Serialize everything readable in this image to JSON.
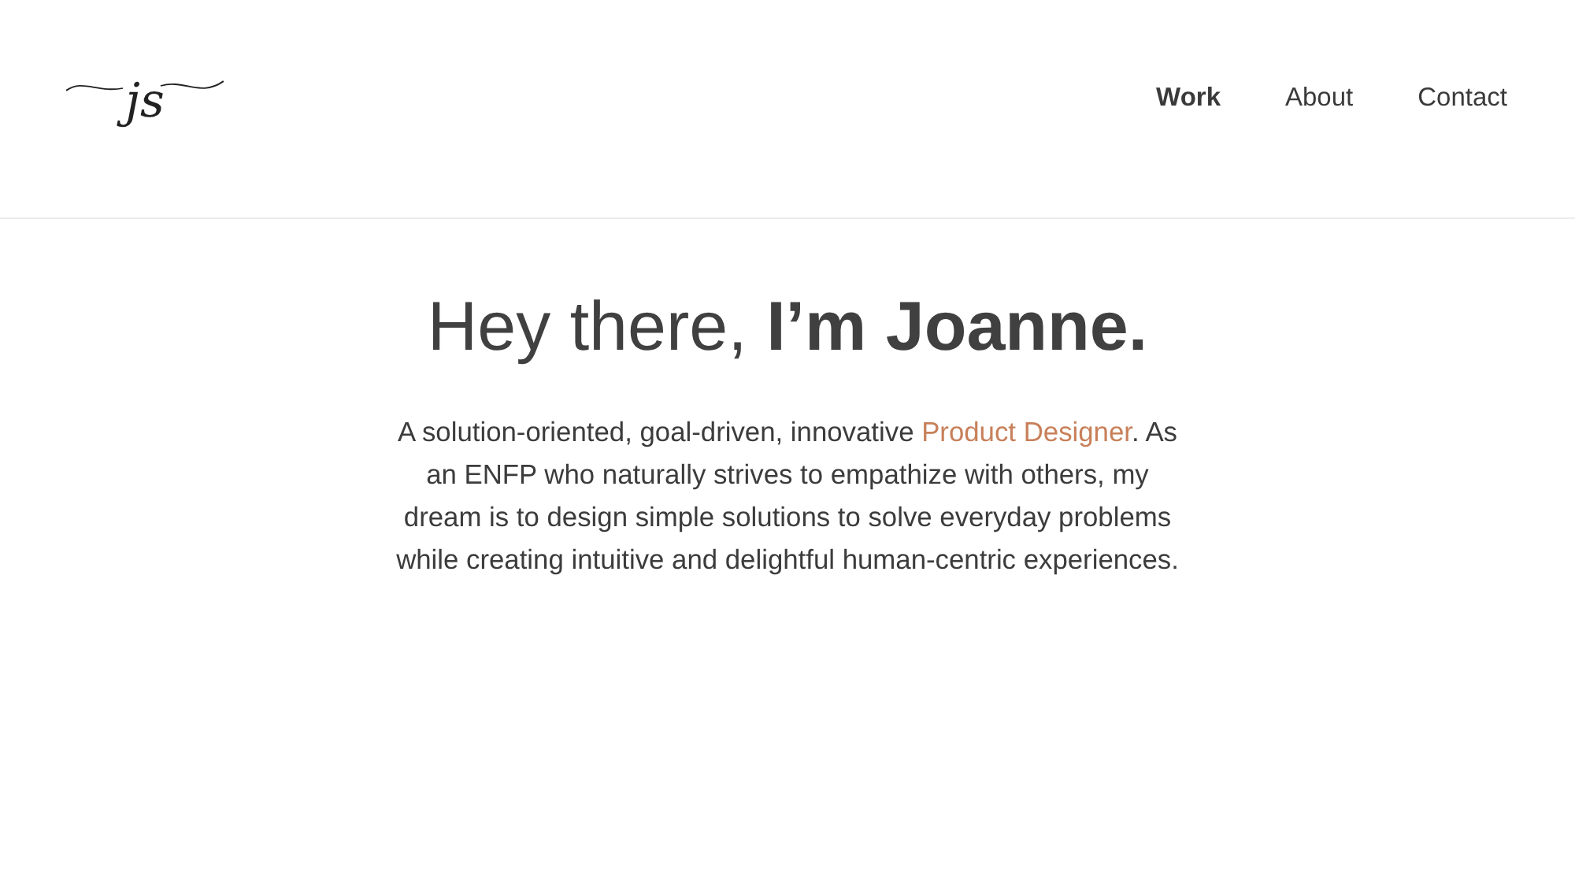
{
  "logo": {
    "text": "js"
  },
  "nav": [
    {
      "label": "Work",
      "selected": true
    },
    {
      "label": "About",
      "selected": false
    },
    {
      "label": "Contact",
      "selected": false
    }
  ],
  "hero": {
    "heading": "Hey there, **I’m Joanne.**",
    "intro_before": "A solution-oriented, goal-driven, innovative ",
    "intro_link": "Product Designer",
    "intro_after": ". As an ENFP who naturally strives to empathize with others, my dream is to design simple solutions to solve everyday problems while creating intuitive and delightful human-centric experiences."
  }
}
